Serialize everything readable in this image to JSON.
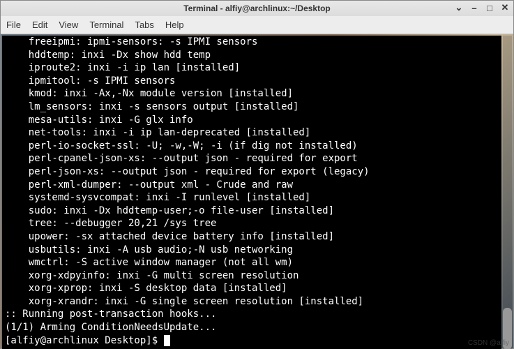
{
  "window": {
    "title": "Terminal - alfiy@archlinux:~/Desktop"
  },
  "menu": {
    "file": "File",
    "edit": "Edit",
    "view": "View",
    "terminal": "Terminal",
    "tabs": "Tabs",
    "help": "Help"
  },
  "watermark": "CSDN @alfiy",
  "terminal": {
    "lines": [
      "    freeipmi: ipmi-sensors: -s IPMI sensors",
      "    hddtemp: inxi -Dx show hdd temp",
      "    iproute2: inxi -i ip lan [installed]",
      "    ipmitool: -s IPMI sensors",
      "    kmod: inxi -Ax,-Nx module version [installed]",
      "    lm_sensors: inxi -s sensors output [installed]",
      "    mesa-utils: inxi -G glx info",
      "    net-tools: inxi -i ip lan-deprecated [installed]",
      "    perl-io-socket-ssl: -U; -w,-W; -i (if dig not installed)",
      "    perl-cpanel-json-xs: --output json - required for export",
      "    perl-json-xs: --output json - required for export (legacy)",
      "    perl-xml-dumper: --output xml - Crude and raw",
      "    systemd-sysvcompat: inxi -I runlevel [installed]",
      "    sudo: inxi -Dx hddtemp-user;-o file-user [installed]",
      "    tree: --debugger 20,21 /sys tree",
      "    upower: -sx attached device battery info [installed]",
      "    usbutils: inxi -A usb audio;-N usb networking",
      "    wmctrl: -S active window manager (not all wm)",
      "    xorg-xdpyinfo: inxi -G multi screen resolution",
      "    xorg-xprop: inxi -S desktop data [installed]",
      "    xorg-xrandr: inxi -G single screen resolution [installed]",
      ":: Running post-transaction hooks...",
      "(1/1) Arming ConditionNeedsUpdate..."
    ],
    "prompt": "[alfiy@archlinux Desktop]$ "
  }
}
